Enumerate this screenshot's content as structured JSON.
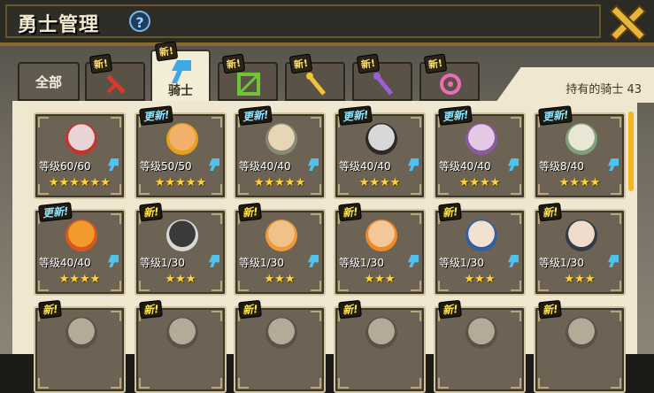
{
  "header": {
    "title": "勇士管理",
    "help_glyph": "?"
  },
  "tabs": {
    "all_label": "全部",
    "knight_label": "骑士",
    "new_badge": "新!",
    "icons": [
      "sword-red",
      "axe-blue",
      "bow-green",
      "staff-yellow",
      "staff-purple",
      "orb-pink"
    ]
  },
  "owned_label": "持有的骑士 43",
  "cards": [
    {
      "tag": "",
      "level": "等级60/60",
      "stars": "★★★★★★",
      "portrait": "#e8d3d6",
      "accent": "#c2352e"
    },
    {
      "tag": "更新!",
      "level": "等级50/50",
      "stars": "★★★★★",
      "portrait": "#f2b06a",
      "accent": "#e4a11f"
    },
    {
      "tag": "更新!",
      "level": "等级40/40",
      "stars": "★★★★★",
      "portrait": "#e6d6b4",
      "accent": "#8a8a74"
    },
    {
      "tag": "更新!",
      "level": "等级40/40",
      "stars": "★★★★",
      "portrait": "#d8d8d8",
      "accent": "#2a2a2a"
    },
    {
      "tag": "更新!",
      "level": "等级40/40",
      "stars": "★★★★",
      "portrait": "#e3c9e6",
      "accent": "#8d5aa0"
    },
    {
      "tag": "更新!",
      "level": "等级8/40",
      "stars": "★★★★",
      "portrait": "#e8e6d4",
      "accent": "#7fa07a"
    },
    {
      "tag": "更新!",
      "level": "等级40/40",
      "stars": "★★★★",
      "portrait": "#f29a2c",
      "accent": "#d9581b"
    },
    {
      "tag": "新!",
      "level": "等级1/30",
      "stars": "★★★",
      "portrait": "#3a3a3a",
      "accent": "#d8d8d8"
    },
    {
      "tag": "新!",
      "level": "等级1/30",
      "stars": "★★★",
      "portrait": "#f0c28a",
      "accent": "#f09b3b"
    },
    {
      "tag": "新!",
      "level": "等级1/30",
      "stars": "★★★",
      "portrait": "#f3c79a",
      "accent": "#f08a28"
    },
    {
      "tag": "新!",
      "level": "等级1/30",
      "stars": "★★★",
      "portrait": "#f1e1cf",
      "accent": "#2f5fa6"
    },
    {
      "tag": "新!",
      "level": "等级1/30",
      "stars": "★★★",
      "portrait": "#f0dccb",
      "accent": "#2f3b4a"
    },
    {
      "tag": "新!",
      "level": "",
      "stars": "",
      "portrait": "#b4aa98",
      "accent": "#5a5248"
    },
    {
      "tag": "新!",
      "level": "",
      "stars": "",
      "portrait": "#b4aa98",
      "accent": "#5a5248"
    },
    {
      "tag": "新!",
      "level": "",
      "stars": "",
      "portrait": "#b4aa98",
      "accent": "#5a5248"
    },
    {
      "tag": "新!",
      "level": "",
      "stars": "",
      "portrait": "#b4aa98",
      "accent": "#5a5248"
    },
    {
      "tag": "新!",
      "level": "",
      "stars": "",
      "portrait": "#b4aa98",
      "accent": "#5a5248"
    },
    {
      "tag": "新!",
      "level": "",
      "stars": "",
      "portrait": "#b4aa98",
      "accent": "#5a5248"
    }
  ]
}
